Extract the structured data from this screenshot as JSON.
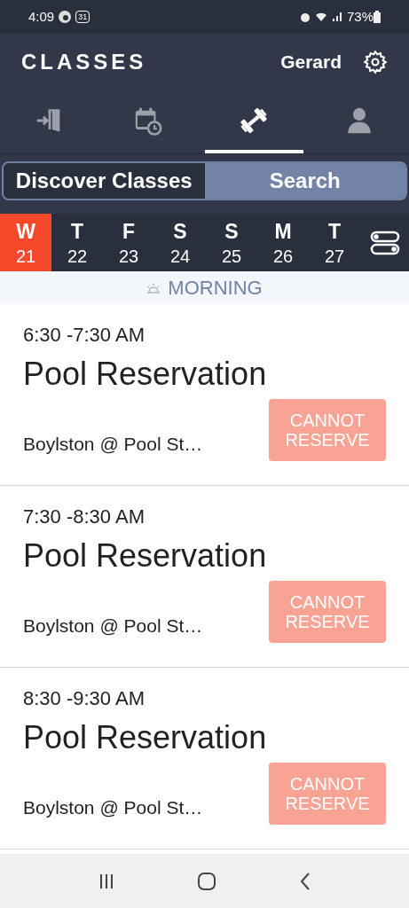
{
  "status_bar": {
    "time": "4:09",
    "calendar_badge": "31",
    "battery": "73%"
  },
  "header": {
    "title": "CLASSES",
    "user": "Gerard"
  },
  "nav_tabs": [
    {
      "kind": "checkin",
      "selected": false
    },
    {
      "kind": "schedule",
      "selected": false
    },
    {
      "kind": "classes",
      "selected": true
    },
    {
      "kind": "profile",
      "selected": false
    }
  ],
  "segments": [
    {
      "label": "Discover Classes",
      "selected": true
    },
    {
      "label": "Search",
      "selected": false
    }
  ],
  "days": [
    {
      "letter": "W",
      "date": "21",
      "selected": true
    },
    {
      "letter": "T",
      "date": "22",
      "selected": false
    },
    {
      "letter": "F",
      "date": "23",
      "selected": false
    },
    {
      "letter": "S",
      "date": "24",
      "selected": false
    },
    {
      "letter": "S",
      "date": "25",
      "selected": false
    },
    {
      "letter": "M",
      "date": "26",
      "selected": false
    },
    {
      "letter": "T",
      "date": "27",
      "selected": false
    }
  ],
  "section": "MORNING",
  "classes": [
    {
      "time": "6:30 -7:30 AM",
      "name": "Pool Reservation",
      "location": "Boylston @ Pool St…",
      "action": "CANNOT RESERVE",
      "disabled": true
    },
    {
      "time": "7:30 -8:30 AM",
      "name": "Pool Reservation",
      "location": "Boylston @ Pool St…",
      "action": "CANNOT RESERVE",
      "disabled": true
    },
    {
      "time": "8:30 -9:30 AM",
      "name": "Pool Reservation",
      "location": "Boylston @ Pool St…",
      "action": "CANNOT RESERVE",
      "disabled": true
    }
  ]
}
